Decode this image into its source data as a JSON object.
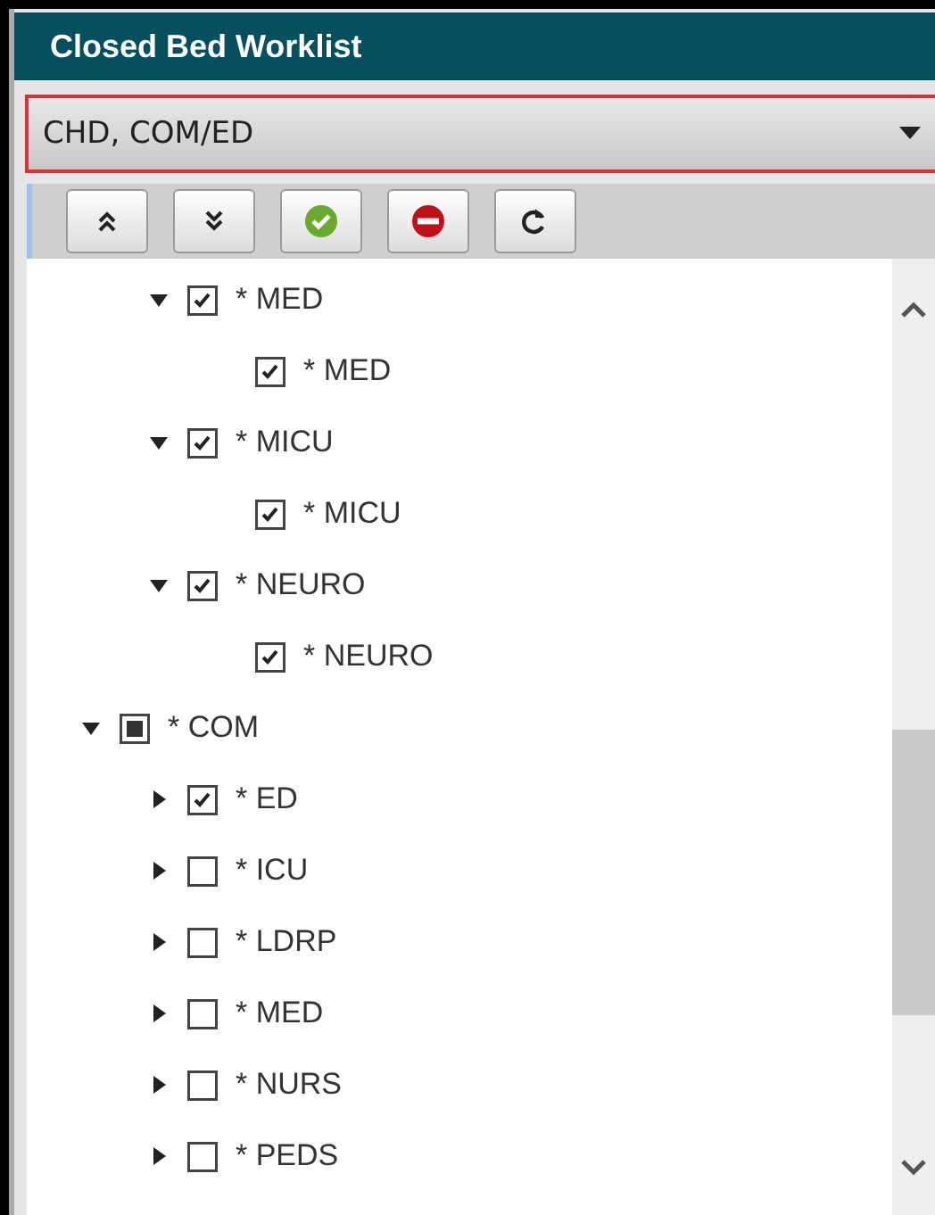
{
  "window": {
    "title": "Closed Bed Worklist"
  },
  "filter": {
    "value": "CHD, COM/ED"
  },
  "toolbar": [
    {
      "kind": "expand_all"
    },
    {
      "kind": "collapse_all"
    },
    {
      "kind": "select_all"
    },
    {
      "kind": "clear_all"
    },
    {
      "kind": "refresh"
    }
  ],
  "tree": [
    {
      "children": [
        {
          "label": "* MED",
          "checked": true,
          "partial": false,
          "expanded": true,
          "children": [
            {
              "label": "* MED",
              "checked": true,
              "partial": false
            }
          ]
        },
        {
          "label": "* MICU",
          "checked": true,
          "partial": false,
          "expanded": true,
          "children": [
            {
              "label": "* MICU",
              "checked": true,
              "partial": false
            }
          ]
        },
        {
          "label": "* NEURO",
          "checked": true,
          "partial": false,
          "expanded": true,
          "children": [
            {
              "label": "* NEURO",
              "checked": true,
              "partial": false
            }
          ]
        }
      ]
    },
    {
      "label": "* COM",
      "checked": false,
      "partial": true,
      "expanded": true,
      "children": [
        {
          "label": "* ED",
          "checked": true,
          "partial": false,
          "expanded": false
        },
        {
          "label": "* ICU",
          "checked": false,
          "partial": false,
          "expanded": false
        },
        {
          "label": "* LDRP",
          "checked": false,
          "partial": false,
          "expanded": false
        },
        {
          "label": "* MED",
          "checked": false,
          "partial": false,
          "expanded": false
        },
        {
          "label": "* NURS",
          "checked": false,
          "partial": false,
          "expanded": false
        },
        {
          "label": "* PEDS",
          "checked": false,
          "partial": false,
          "expanded": false
        }
      ]
    }
  ]
}
